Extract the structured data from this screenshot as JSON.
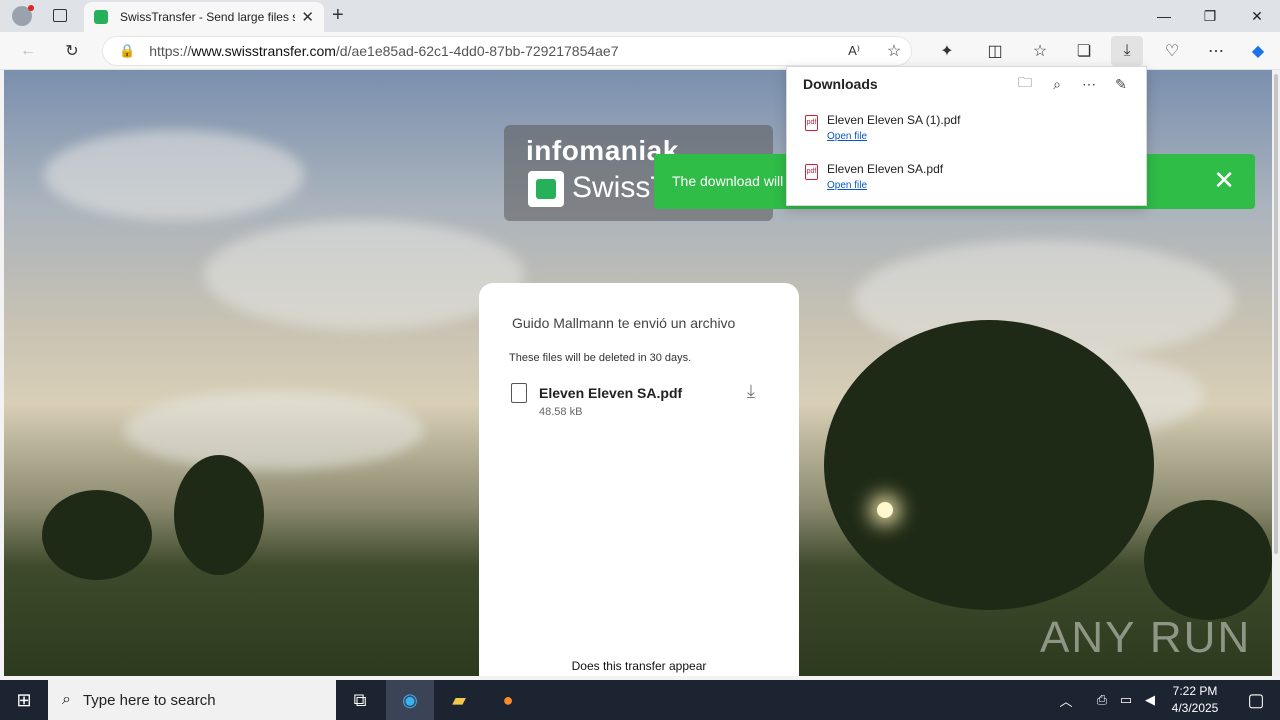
{
  "browser": {
    "tab_title": "SwissTransfer - Send large files se",
    "new_tab_icon": "+",
    "url_prefix": "https://",
    "url_host": "www.swisstransfer.com",
    "url_path": "/d/ae1e85ad-62c1-4dd0-87bb-729217854ae7"
  },
  "page": {
    "brand_top": "infomaniak",
    "brand_bottom": "SwissT",
    "toast_message": "The download will",
    "sender_line": "Guido Mallmann te envió un archivo",
    "deletion_note": "These files will be deleted in 30 days.",
    "file_name": "Eleven Eleven SA.pdf",
    "file_size": "48.58 kB",
    "footer_text": "Does this transfer appear",
    "watermark": "ANY RUN"
  },
  "downloads": {
    "title": "Downloads",
    "items": [
      {
        "name": "Eleven Eleven SA (1).pdf",
        "action": "Open file"
      },
      {
        "name": "Eleven Eleven SA.pdf",
        "action": "Open file"
      }
    ]
  },
  "taskbar": {
    "search_placeholder": "Type here to search",
    "time": "7:22 PM",
    "date": "4/3/2025"
  },
  "colors": {
    "toast": "#2fbc47",
    "link": "#0b57c2",
    "taskbar": "#1c2432"
  }
}
